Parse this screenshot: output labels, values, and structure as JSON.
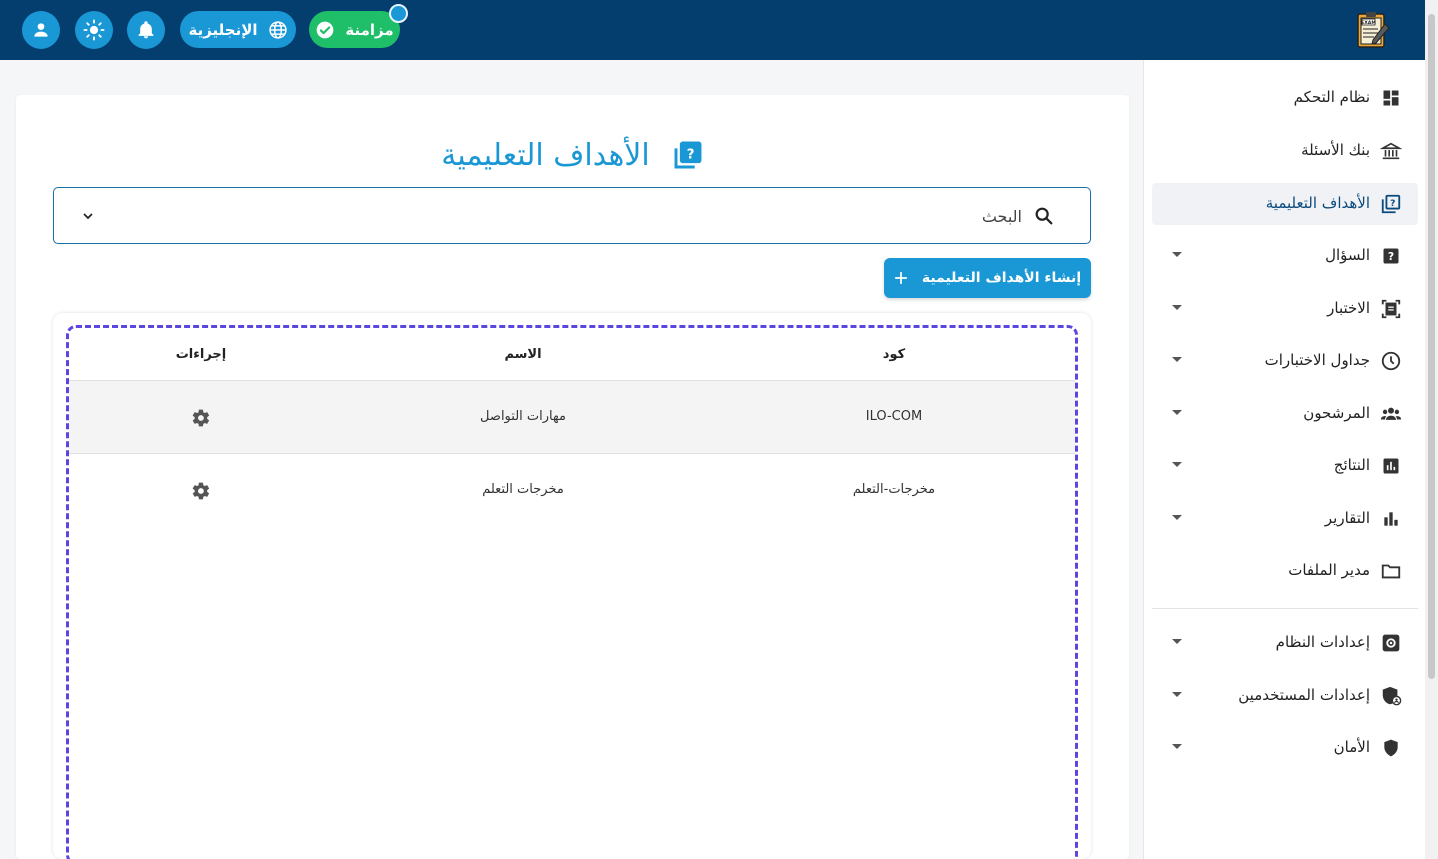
{
  "header": {
    "sync_label": "مزامنة",
    "language_label": "الإنجليزية",
    "logo_text": "EXAM"
  },
  "sidebar": {
    "items": [
      {
        "label": "نظام التحكم",
        "icon": "dashboard-icon",
        "has_submenu": false,
        "active": false
      },
      {
        "label": "بنك الأسئلة",
        "icon": "bank-icon",
        "has_submenu": false,
        "active": false
      },
      {
        "label": "الأهداف التعليمية",
        "icon": "quiz-book-icon",
        "has_submenu": false,
        "active": true
      },
      {
        "label": "السؤال",
        "icon": "question-icon",
        "has_submenu": true,
        "active": false
      },
      {
        "label": "الاختبار",
        "icon": "exam-icon",
        "has_submenu": true,
        "active": false
      },
      {
        "label": "جداول الاختبارات",
        "icon": "clock-icon",
        "has_submenu": true,
        "active": false
      },
      {
        "label": "المرشحون",
        "icon": "candidates-icon",
        "has_submenu": true,
        "active": false
      },
      {
        "label": "النتائج",
        "icon": "results-chart-icon",
        "has_submenu": true,
        "active": false
      },
      {
        "label": "التقارير",
        "icon": "bar-chart-icon",
        "has_submenu": true,
        "active": false
      },
      {
        "label": "مدير الملفات",
        "icon": "folder-icon",
        "has_submenu": false,
        "active": false
      },
      {
        "label": "إعدادات النظام",
        "icon": "settings-icon",
        "has_submenu": true,
        "active": false
      },
      {
        "label": "إعدادات المستخدمين",
        "icon": "user-shield-icon",
        "has_submenu": true,
        "active": false
      },
      {
        "label": "الأمان",
        "icon": "shield-icon",
        "has_submenu": true,
        "active": false
      }
    ]
  },
  "main": {
    "title": "الأهداف التعليمية",
    "search": {
      "placeholder": "البحث",
      "value": ""
    },
    "create_button": "إنشاء الأهداف التعليمية",
    "table": {
      "columns": {
        "code": "كود",
        "name": "الاسم",
        "actions": "إجراءات"
      },
      "rows": [
        {
          "code": "ILO-COM",
          "name": "مهارات التواصل"
        },
        {
          "code": "مخرجات-التعلم",
          "name": "مخرجات التعلم"
        }
      ]
    }
  },
  "colors": {
    "topbar": "#043e6f",
    "accent": "#1a97d5",
    "sync_green": "#1fbf6a",
    "selection_dash": "#5b47e0"
  }
}
